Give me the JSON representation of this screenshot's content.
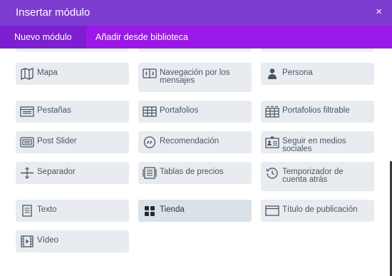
{
  "header": {
    "title": "Insertar módulo",
    "close_icon": "×"
  },
  "tabs": [
    {
      "label": "Nuevo módulo",
      "active": true
    },
    {
      "label": "Añadir desde biblioteca",
      "active": false
    }
  ],
  "modules": [
    {
      "name": "mapa",
      "label": "Mapa",
      "icon": "map-icon"
    },
    {
      "name": "navegacion-por-los-mensajes",
      "label": "Navegación por los mensajes",
      "icon": "post-navigation-icon"
    },
    {
      "name": "persona",
      "label": "Persona",
      "icon": "person-icon"
    },
    {
      "name": "pestanas",
      "label": "Pestañas",
      "icon": "tabs-icon"
    },
    {
      "name": "portafolios",
      "label": "Portafolios",
      "icon": "portfolio-grid-icon"
    },
    {
      "name": "portafolios-filtrable",
      "label": "Portafolios filtrable",
      "icon": "filterable-portfolio-icon"
    },
    {
      "name": "post-slider",
      "label": "Post Slider",
      "icon": "post-slider-icon"
    },
    {
      "name": "recomendacion",
      "label": "Recomendación",
      "icon": "quote-icon"
    },
    {
      "name": "seguir-en-medios-sociales",
      "label": "Seguir en medios sociales",
      "icon": "social-follow-icon"
    },
    {
      "name": "separador",
      "label": "Separador",
      "icon": "divider-icon"
    },
    {
      "name": "tablas-de-precios",
      "label": "Tablas de precios",
      "icon": "pricing-tables-icon"
    },
    {
      "name": "temporizador-de-cuenta-atras",
      "label": "Temporizador de cuenta atrás",
      "icon": "countdown-timer-icon"
    },
    {
      "name": "texto",
      "label": "Texto",
      "icon": "text-icon"
    },
    {
      "name": "tienda",
      "label": "Tienda",
      "icon": "shop-icon",
      "active": true
    },
    {
      "name": "titulo-de-publicacion",
      "label": "Título de publicación",
      "icon": "post-title-icon"
    },
    {
      "name": "video",
      "label": "Vídeo",
      "icon": "video-icon"
    }
  ],
  "colors": {
    "titlebar": "#7e3bd0",
    "tabbar": "#9b19e8",
    "active_tab": "#7d1fd0",
    "card": "#e8ecf0"
  }
}
